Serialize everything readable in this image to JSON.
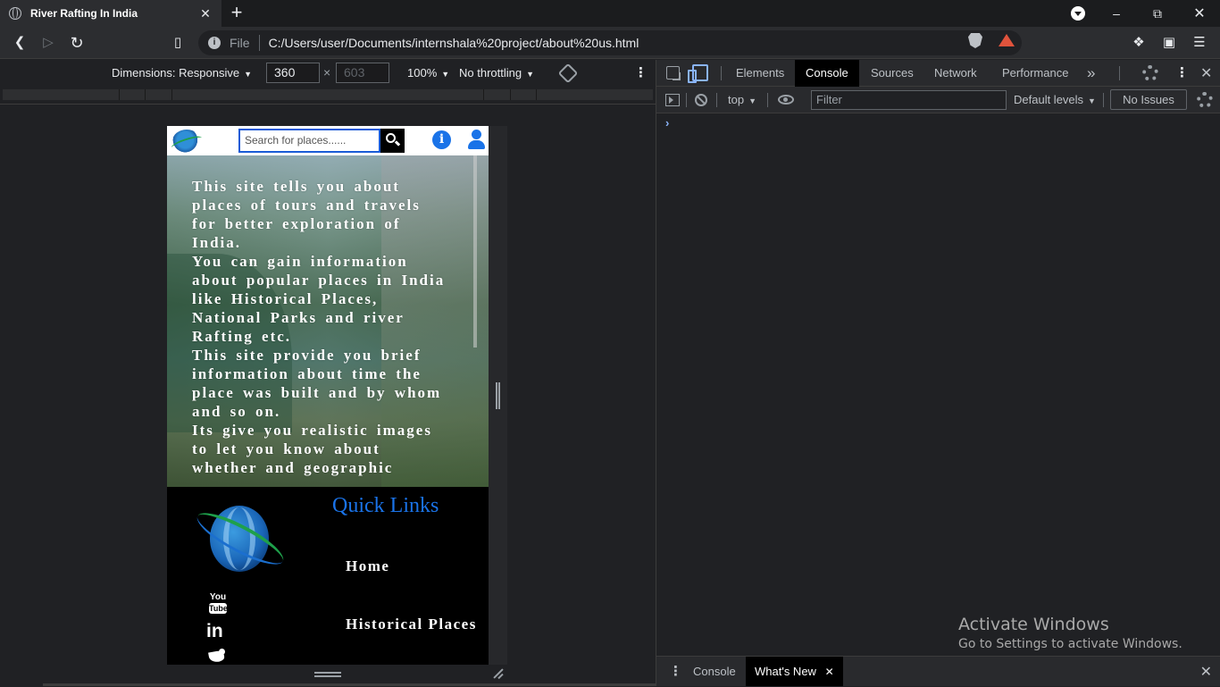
{
  "browser": {
    "tab_title": "River Rafting In India",
    "tab_close": "✕",
    "new_tab": "+",
    "file_label": "File",
    "url": "C:/Users/user/Documents/internshala%20project/about%20us.html",
    "info_glyph": "i"
  },
  "device_toolbar": {
    "dimensions_label": "Dimensions: Responsive",
    "width": "360",
    "height_placeholder": "603",
    "times": "×",
    "zoom": "100%",
    "throttling": "No throttling",
    "caret": "▼"
  },
  "site": {
    "search_placeholder": "Search for places......",
    "info_glyph": "i",
    "hero_paragraphs": [
      "This site tells you about places of tours and travels for better exploration of India.",
      "You can gain information about popular places in India like Historical Places, National Parks and river Rafting etc.",
      "This site provide you brief information about time the place was built and by whom and so on.",
      "Its give you realistic images to let you know about whether and geographic"
    ],
    "footer": {
      "quick_links_title": "Quick Links",
      "links": [
        "Home",
        "Historical Places"
      ],
      "youtube_you": "You",
      "youtube_tube": "Tube",
      "linkedin": "in"
    }
  },
  "devtools": {
    "tabs": [
      "Elements",
      "Console",
      "Sources",
      "Network",
      "Performance"
    ],
    "active_tab": "Console",
    "more": "»",
    "close": "✕",
    "console": {
      "context": "top",
      "filter_placeholder": "Filter",
      "levels": "Default levels",
      "issues": "No Issues",
      "prompt": "›"
    },
    "drawer": {
      "tabs": [
        "Console",
        "What's New"
      ],
      "active_tab": "What's New",
      "tab_close": "✕",
      "close": "✕"
    }
  },
  "watermark": {
    "line1": "Activate Windows",
    "line2": "Go to Settings to activate Windows."
  },
  "colors": {
    "accent": "#1a73e8",
    "devtools_link": "#8ab4f8"
  }
}
